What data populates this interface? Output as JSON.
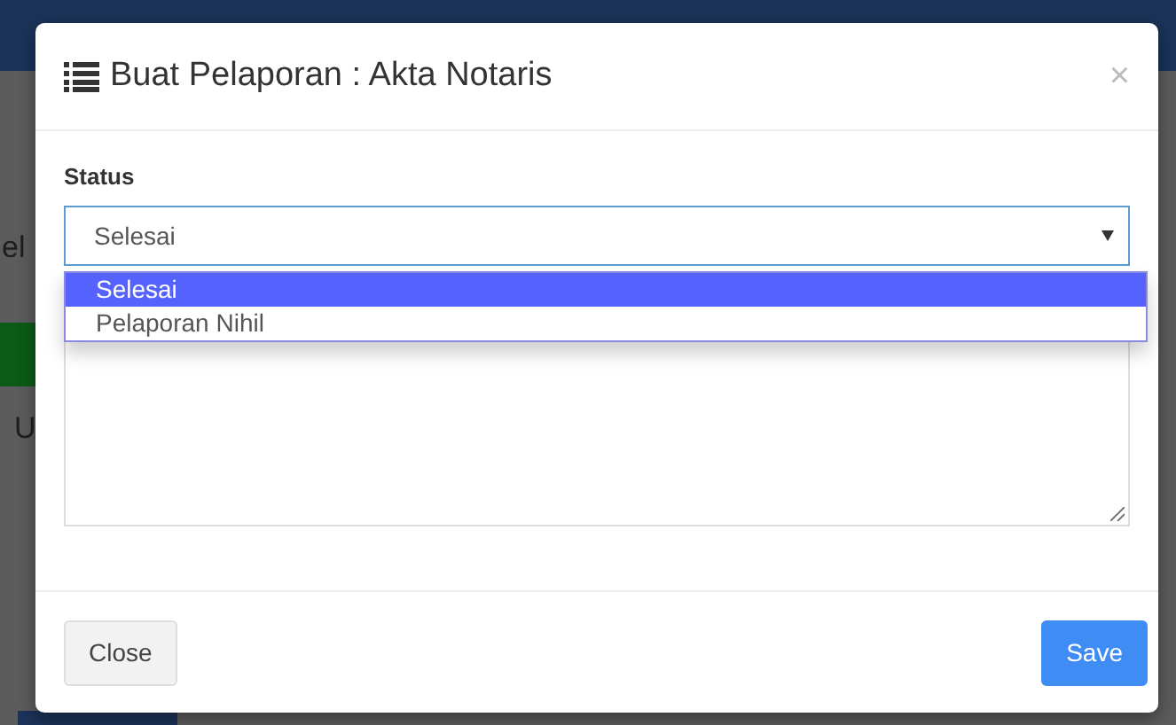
{
  "backdrop": {
    "fragments": [
      "el",
      "U"
    ]
  },
  "modal": {
    "title": "Buat Pelaporan : Akta Notaris",
    "close_symbol": "×",
    "status": {
      "label": "Status",
      "value": "Selesai",
      "expanded": true,
      "options": [
        {
          "label": "Selesai",
          "selected": true
        },
        {
          "label": "Pelaporan Nihil",
          "selected": false
        }
      ]
    },
    "buttons": [
      {
        "label": "Close",
        "kind": "secondary"
      },
      {
        "label": "Save",
        "kind": "primary"
      }
    ]
  }
}
